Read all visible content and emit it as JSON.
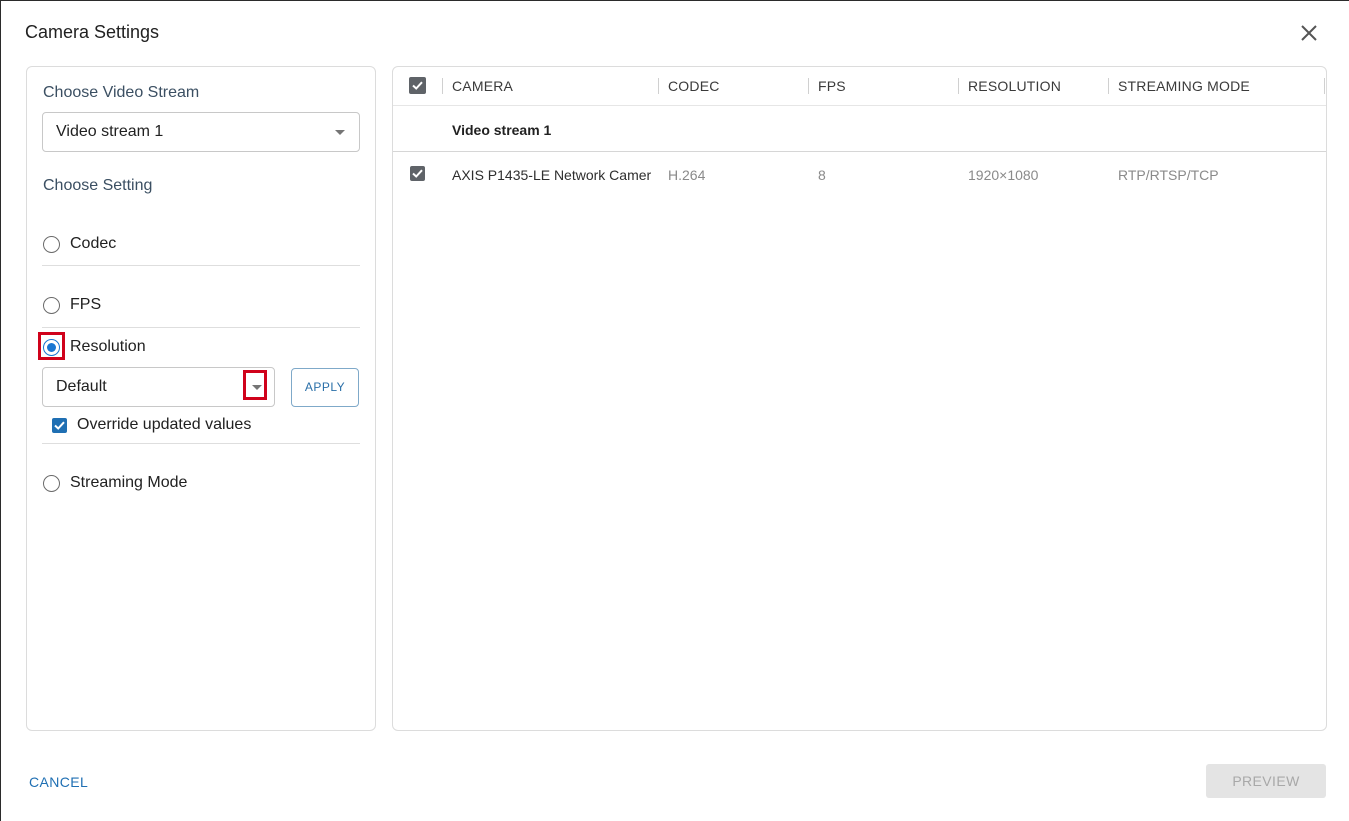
{
  "dialog": {
    "title": "Camera Settings"
  },
  "left": {
    "video_stream_label": "Choose Video Stream",
    "video_stream_value": "Video stream 1",
    "setting_label": "Choose Setting",
    "options": {
      "codec": "Codec",
      "fps": "FPS",
      "resolution": "Resolution",
      "streaming_mode": "Streaming Mode"
    },
    "selected_option": "Resolution",
    "resolution_value": "Default",
    "apply_label": "APPLY",
    "override_label": "Override updated values",
    "override_checked": true
  },
  "table": {
    "headers": {
      "camera": "CAMERA",
      "codec": "CODEC",
      "fps": "FPS",
      "resolution": "RESOLUTION",
      "streaming_mode": "STREAMING MODE"
    },
    "group_title": "Video stream 1",
    "rows": [
      {
        "camera": "AXIS P1435-LE Network Camer",
        "codec": "H.264",
        "fps": "8",
        "resolution": "1920×1080",
        "streaming_mode": "RTP/RTSP/TCP",
        "checked": true
      }
    ]
  },
  "footer": {
    "cancel_label": "CANCEL",
    "preview_label": "PREVIEW"
  },
  "colors": {
    "accent": "#1f6fb3",
    "highlight": "#d0021b",
    "disabled_bg": "#e4e4e4"
  }
}
